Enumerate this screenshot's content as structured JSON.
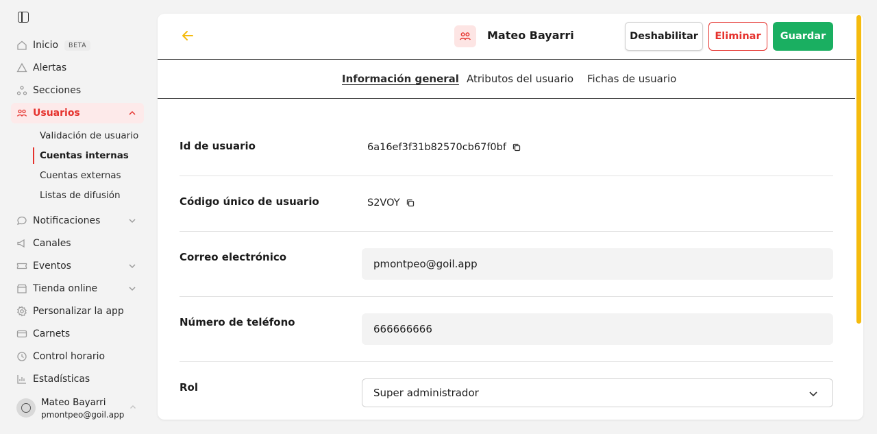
{
  "sidebar": {
    "items": [
      {
        "label": "Inicio",
        "badge": "BETA",
        "icon": "home-icon"
      },
      {
        "label": "Alertas",
        "icon": "bell-icon"
      },
      {
        "label": "Secciones",
        "icon": "sections-icon"
      },
      {
        "label": "Usuarios",
        "icon": "users-icon",
        "expanded": true,
        "active": true
      },
      {
        "label": "Notificaciones",
        "icon": "chat-icon"
      },
      {
        "label": "Canales",
        "icon": "megaphone-icon"
      },
      {
        "label": "Eventos",
        "icon": "ticket-icon"
      },
      {
        "label": "Tienda online",
        "icon": "store-icon"
      },
      {
        "label": "Personalizar la app",
        "icon": "gear-icon"
      },
      {
        "label": "Carnets",
        "icon": "card-icon"
      },
      {
        "label": "Control horario",
        "icon": "clock-icon"
      },
      {
        "label": "Estadísticas",
        "icon": "stats-icon"
      }
    ],
    "subitems": [
      {
        "label": "Validación de usuario"
      },
      {
        "label": "Cuentas internas",
        "current": true
      },
      {
        "label": "Cuentas externas"
      },
      {
        "label": "Listas de difusión"
      }
    ],
    "user": {
      "name": "Mateo Bayarri",
      "email": "pmontpeo@goil.app"
    }
  },
  "header": {
    "name": "Mateo Bayarri",
    "disable_label": "Deshabilitar",
    "delete_label": "Eliminar",
    "save_label": "Guardar"
  },
  "tabs": [
    {
      "label": "Información general",
      "selected": true
    },
    {
      "label": "Atributos del usuario"
    },
    {
      "label": "Fichas de usuario"
    }
  ],
  "form": {
    "user_id": {
      "label": "Id de usuario",
      "value": "6a16ef3f31b82570cb67f0bf"
    },
    "unique_code": {
      "label": "Código único de usuario",
      "value": "S2VOY"
    },
    "email": {
      "label": "Correo electrónico",
      "value": "pmontpeo@goil.app"
    },
    "phone": {
      "label": "Número de teléfono",
      "value": "666666666"
    },
    "role": {
      "label": "Rol",
      "value": "Super administrador"
    }
  },
  "colors": {
    "accent_red": "#e5322d",
    "save_green": "#1aaf61",
    "back_yellow": "#f5bb0e"
  }
}
